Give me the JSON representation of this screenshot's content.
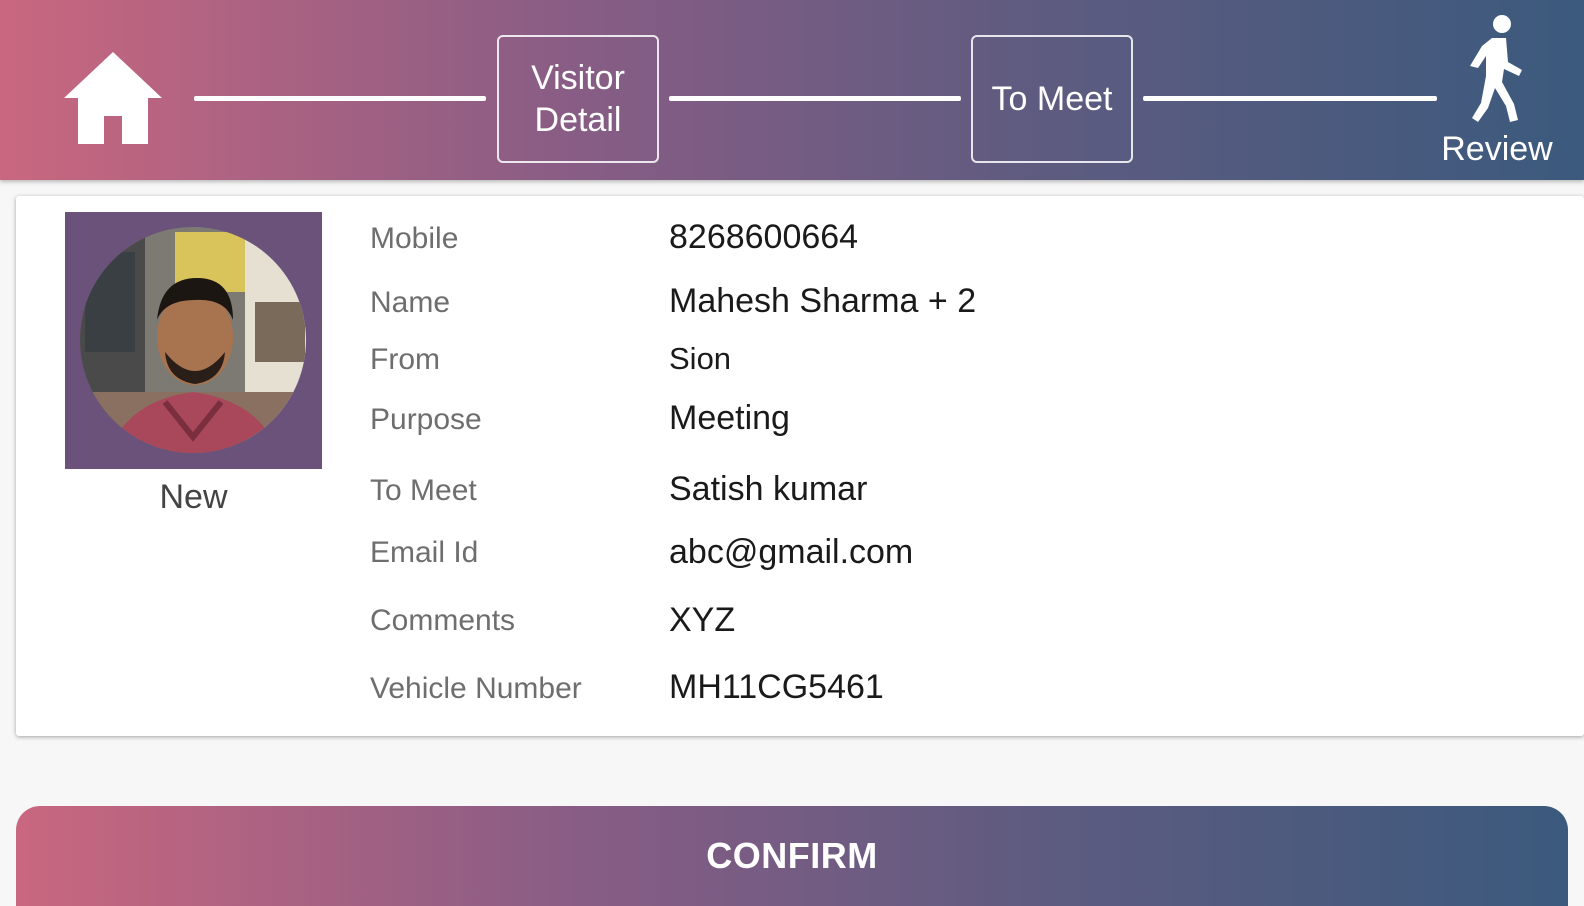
{
  "header": {
    "steps": [
      {
        "label": "Visitor\nDetail"
      },
      {
        "label": "To Meet"
      },
      {
        "label": "Review"
      }
    ],
    "colors": {
      "gradient_start": "#c9677f",
      "gradient_end": "#3b5a7d"
    },
    "icons": {
      "home": "home-icon",
      "review": "walking-person-icon"
    }
  },
  "visitor": {
    "photo_label": "New",
    "fields": [
      {
        "label": "Mobile",
        "value": "8268600664"
      },
      {
        "label": "Name",
        "value": "Mahesh Sharma + 2"
      },
      {
        "label": "From",
        "value": "Sion"
      },
      {
        "label": "Purpose",
        "value": "Meeting"
      },
      {
        "label": "To Meet",
        "value": "Satish kumar"
      },
      {
        "label": "Email Id",
        "value": "abc@gmail.com"
      },
      {
        "label": "Comments",
        "value": "XYZ"
      },
      {
        "label": "Vehicle Number",
        "value": "MH11CG5461"
      }
    ]
  },
  "actions": {
    "confirm_label": "CONFIRM"
  }
}
